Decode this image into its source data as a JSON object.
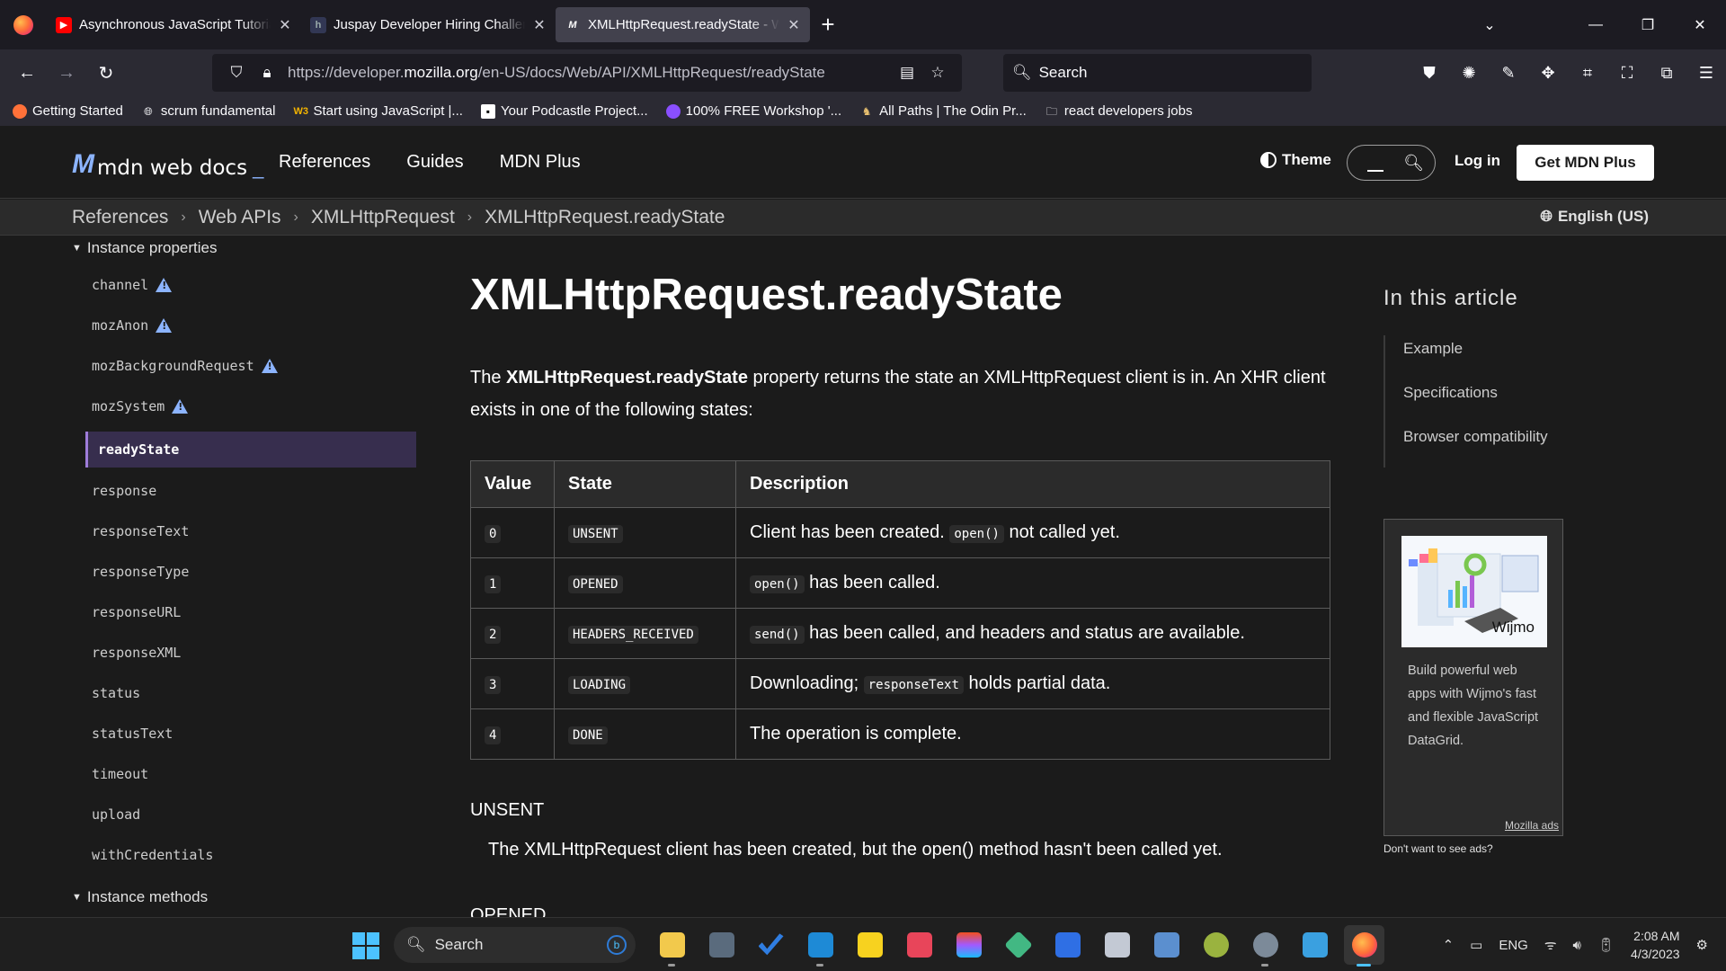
{
  "browser": {
    "tabs": [
      {
        "title": "Asynchronous JavaScript Tutorial",
        "favicon": "youtube-icon",
        "active": false
      },
      {
        "title": "Juspay Developer Hiring Challenge",
        "favicon": "hackerearth-icon",
        "active": false
      },
      {
        "title": "XMLHttpRequest.readyState - Web APIs",
        "favicon": "mdn-icon",
        "active": true
      }
    ],
    "url_prefix": "https://developer.",
    "url_domain": "mozilla.org",
    "url_path": "/en-US/docs/Web/API/XMLHttpRequest/readyState",
    "search_placeholder": "Search",
    "bookmarks": [
      "Getting Started",
      "scrum fundamental",
      "Start using JavaScript |...",
      "Your Podcastle Project...",
      "100% FREE Workshop '...",
      "All Paths | The Odin Pr...",
      "react developers jobs"
    ]
  },
  "header": {
    "logo_text": "mdn web docs",
    "nav": [
      "References",
      "Guides",
      "MDN Plus"
    ],
    "theme_label": "Theme",
    "login_label": "Log in",
    "cta_label": "Get MDN Plus"
  },
  "breadcrumbs": [
    "References",
    "Web APIs",
    "XMLHttpRequest",
    "XMLHttpRequest.readyState"
  ],
  "language": "English (US)",
  "sidebar": {
    "section1": "Instance properties",
    "items": [
      {
        "label": "channel",
        "warn": true
      },
      {
        "label": "mozAnon",
        "warn": true
      },
      {
        "label": "mozBackgroundRequest",
        "warn": true
      },
      {
        "label": "mozSystem",
        "warn": true
      },
      {
        "label": "readyState",
        "active": true
      },
      {
        "label": "response"
      },
      {
        "label": "responseText"
      },
      {
        "label": "responseType"
      },
      {
        "label": "responseURL"
      },
      {
        "label": "responseXML"
      },
      {
        "label": "status"
      },
      {
        "label": "statusText"
      },
      {
        "label": "timeout"
      },
      {
        "label": "upload"
      },
      {
        "label": "withCredentials"
      }
    ],
    "section2": "Instance methods"
  },
  "article": {
    "title": "XMLHttpRequest.readyState",
    "intro_pre": "The ",
    "intro_bold": "XMLHttpRequest.readyState",
    "intro_post": " property returns the state an XMLHttpRequest client is in. An XHR client exists in one of the following states:",
    "table_headers": [
      "Value",
      "State",
      "Description"
    ],
    "rows": [
      {
        "value": "0",
        "state": "UNSENT",
        "pre": "Client has been created. ",
        "code": "open()",
        "post": " not called yet."
      },
      {
        "value": "1",
        "state": "OPENED",
        "pre": "",
        "code": "open()",
        "post": " has been called."
      },
      {
        "value": "2",
        "state": "HEADERS_RECEIVED",
        "pre": "",
        "code": "send()",
        "post": " has been called, and headers and status are available."
      },
      {
        "value": "3",
        "state": "LOADING",
        "pre": "Downloading; ",
        "code": "responseText",
        "post": " holds partial data."
      },
      {
        "value": "4",
        "state": "DONE",
        "pre": "The operation is complete.",
        "code": "",
        "post": ""
      }
    ],
    "unsent_heading": "UNSENT",
    "unsent_desc": "The XMLHttpRequest client has been created, but the open() method hasn't been called yet.",
    "opened_heading": "OPENED"
  },
  "toc": {
    "heading": "In this article",
    "items": [
      "Example",
      "Specifications",
      "Browser compatibility"
    ]
  },
  "ad": {
    "brand": "Wijmo",
    "text": "Build powerful web apps with Wijmo's fast and flexible JavaScript DataGrid.",
    "link": "Mozilla ads",
    "noads": "Don't want to see ads?"
  },
  "taskbar": {
    "search_label": "Search",
    "lang": "ENG",
    "time": "2:08 AM",
    "date": "4/3/2023"
  }
}
